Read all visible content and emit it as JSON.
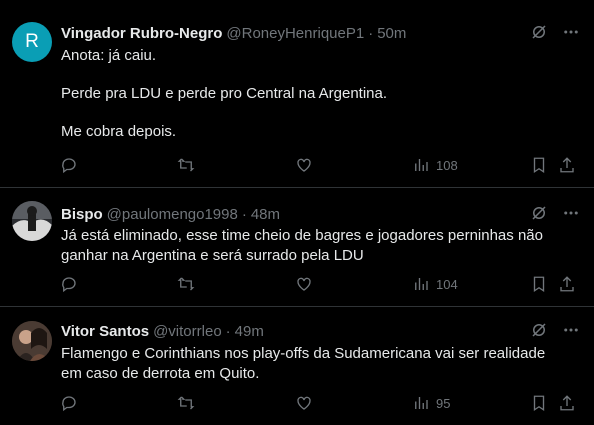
{
  "tweets": [
    {
      "avatar_letter": "R",
      "name": "Vingador Rubro-Negro",
      "handle": "@RoneyHenriqueP1",
      "sep": "·",
      "time": "50m",
      "lines": [
        "Anota: já caiu.",
        "Perde pra LDU e perde pro Central na Argentina.",
        "Me cobra depois."
      ],
      "views": "108"
    },
    {
      "name": "Bispo",
      "handle": "@paulomengo1998",
      "sep": "·",
      "time": "48m",
      "lines": [
        "Já está eliminado, esse time cheio de bagres e jogadores perninhas não",
        "ganhar na Argentina e será surrado pela LDU"
      ],
      "views": "104"
    },
    {
      "name": "Vitor Santos",
      "handle": "@vitorrleo",
      "sep": "·",
      "time": "49m",
      "lines": [
        "Flamengo e Corinthians nos play-offs da Sudamericana vai ser realidade",
        "em caso de derrota em Quito."
      ],
      "views": "95"
    }
  ],
  "icons": {
    "grok": "grok-icon",
    "more": "more-icon",
    "reply": "reply-icon",
    "retweet": "retweet-icon",
    "like": "like-icon",
    "views": "views-icon",
    "bookmark": "bookmark-icon",
    "share": "share-icon"
  },
  "colors": {
    "background": "#000000",
    "text": "#e7e9ea",
    "muted": "#71767b",
    "divider": "#2f3336",
    "avatar_r": "#0a9eb5"
  }
}
